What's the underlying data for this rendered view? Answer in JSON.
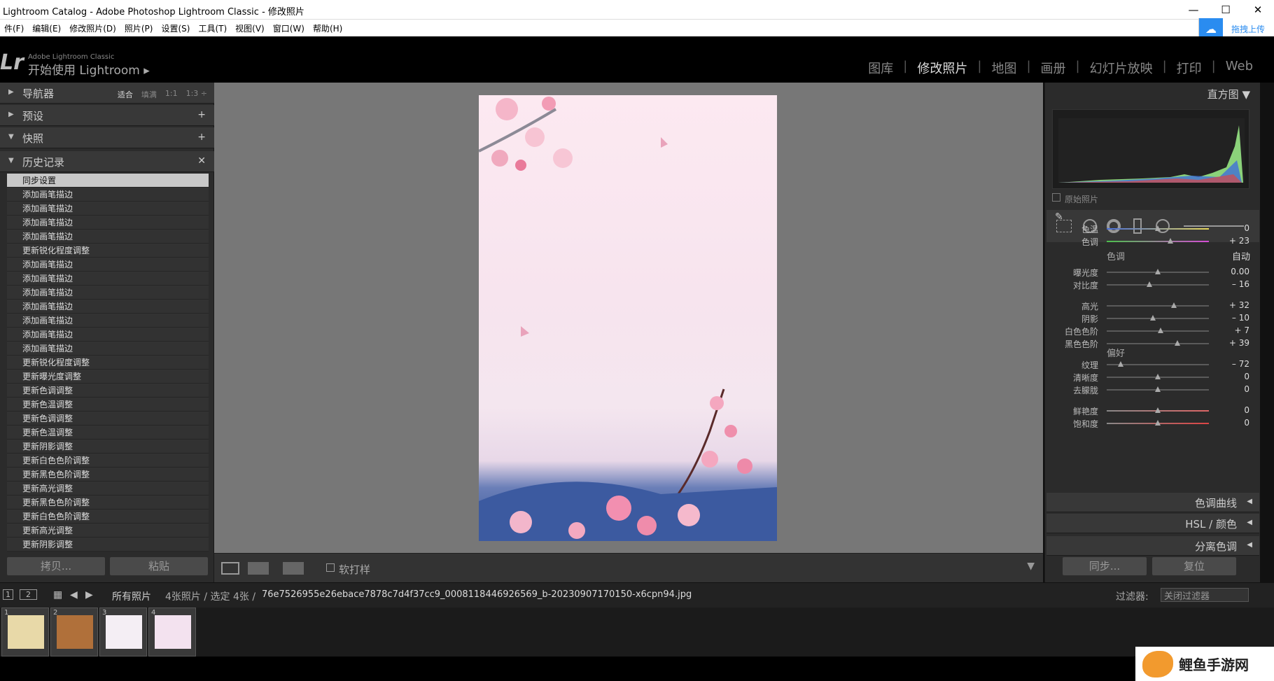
{
  "window": {
    "title": "Lightroom Catalog - Adobe Photoshop Lightroom Classic - 修改照片"
  },
  "menu": [
    "件(F)",
    "编辑(E)",
    "修改照片(D)",
    "照片(P)",
    "设置(S)",
    "工具(T)",
    "视图(V)",
    "窗口(W)",
    "帮助(H)"
  ],
  "upload_label": "拖拽上传",
  "brand": {
    "logo": "Lr",
    "small": "Adobe Lightroom Classic",
    "big": "开始使用 Lightroom ▸"
  },
  "modules": [
    "图库",
    "修改照片",
    "地图",
    "画册",
    "幻灯片放映",
    "打印",
    "Web"
  ],
  "left": {
    "navigator": "导航器",
    "nav_opts": [
      "适合",
      "填满",
      "1:1",
      "1:3 ÷"
    ],
    "presets": "预设",
    "snapshots": "快照",
    "history": "历史记录",
    "history_items": [
      "同步设置",
      "添加画笔描边",
      "添加画笔描边",
      "添加画笔描边",
      "添加画笔描边",
      "更新锐化程度调整",
      "添加画笔描边",
      "添加画笔描边",
      "添加画笔描边",
      "添加画笔描边",
      "添加画笔描边",
      "添加画笔描边",
      "添加画笔描边",
      "更新锐化程度调整",
      "更新曝光度调整",
      "更新色调调整",
      "更新色温调整",
      "更新色调调整",
      "更新色温调整",
      "更新阴影调整",
      "更新白色色阶调整",
      "更新黑色色阶调整",
      "更新高光调整",
      "更新黑色色阶调整",
      "更新白色色阶调整",
      "更新高光调整",
      "更新阴影调整"
    ],
    "copy": "拷贝...",
    "paste": "粘贴"
  },
  "toolbar": {
    "soft_proof": "软打样"
  },
  "right": {
    "histogram": "直方图",
    "original": "原始照片",
    "wb": [
      {
        "label": "色温",
        "value": "0",
        "pos": 0.5
      },
      {
        "label": "色调",
        "value": "+ 23",
        "pos": 0.62
      }
    ],
    "tone_title": "色调",
    "auto": "自动",
    "tone": [
      {
        "label": "曝光度",
        "value": "0.00",
        "pos": 0.5
      },
      {
        "label": "对比度",
        "value": "– 16",
        "pos": 0.42
      }
    ],
    "tone2": [
      {
        "label": "高光",
        "value": "+ 32",
        "pos": 0.66
      },
      {
        "label": "阴影",
        "value": "– 10",
        "pos": 0.45
      },
      {
        "label": "白色色阶",
        "value": "+ 7",
        "pos": 0.53
      },
      {
        "label": "黑色色阶",
        "value": "+ 39",
        "pos": 0.69
      }
    ],
    "presence_title": "偏好",
    "presence": [
      {
        "label": "纹理",
        "value": "– 72",
        "pos": 0.14
      },
      {
        "label": "清晰度",
        "value": "0",
        "pos": 0.5
      },
      {
        "label": "去朦胧",
        "value": "0",
        "pos": 0.5
      }
    ],
    "color": [
      {
        "label": "鲜艳度",
        "value": "0",
        "pos": 0.5
      },
      {
        "label": "饱和度",
        "value": "0",
        "pos": 0.5
      }
    ],
    "panels": [
      "色调曲线",
      "HSL / 颜色",
      "分离色调"
    ],
    "sync": "同步...",
    "reset": "复位"
  },
  "filmbar": {
    "pages": [
      "1",
      "2"
    ],
    "source": "所有照片",
    "info": "4张照片 / 选定 4张 /",
    "filename": "76e7526955e26ebace7878c7d4f37cc9_0008118446926569_b-20230907170150-x6cpn94.jpg",
    "filter_label": "过滤器:",
    "filter_value": "关闭过滤器"
  },
  "thumbs": [
    {
      "num": "1",
      "color": "#e8d9a8"
    },
    {
      "num": "2",
      "color": "#b0703a"
    },
    {
      "num": "3",
      "color": "#f4eef4"
    },
    {
      "num": "4",
      "color": "#f3e2ef"
    }
  ],
  "watermark": "鲤鱼手游网"
}
